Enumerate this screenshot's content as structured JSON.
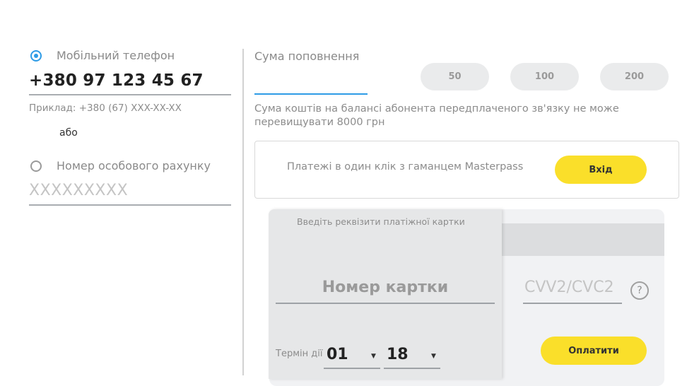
{
  "phone": {
    "label": "Мобільний телефон",
    "value": "+380 97 123 45 67",
    "hint": "Приклад: +380 (67) XXX-XX-XX",
    "selected": true
  },
  "or_text": "або",
  "account": {
    "label": "Номер особового рахунку",
    "placeholder": "XXXXXXXXX"
  },
  "amount": {
    "label": "Сума поповнення",
    "value": "",
    "presets": [
      "50",
      "100",
      "200"
    ],
    "note": "Сума коштів на балансі абонента передплаченого зв'язку не може перевищувати 8000 грн"
  },
  "masterpass": {
    "text": "Платежі в один клік з гаманцем Masterpass",
    "login_label": "Вхід"
  },
  "card": {
    "title": "Введіть реквізити платіжної картки",
    "number_placeholder": "Номер картки",
    "cvv_placeholder": "CVV2/CVC2",
    "help": "?",
    "expiry_label": "Термін дії",
    "month": "01",
    "year": "18",
    "pay_label": "Оплатити"
  },
  "colors": {
    "accent_blue": "#2e9be6",
    "button_yellow": "#fadf2a"
  }
}
